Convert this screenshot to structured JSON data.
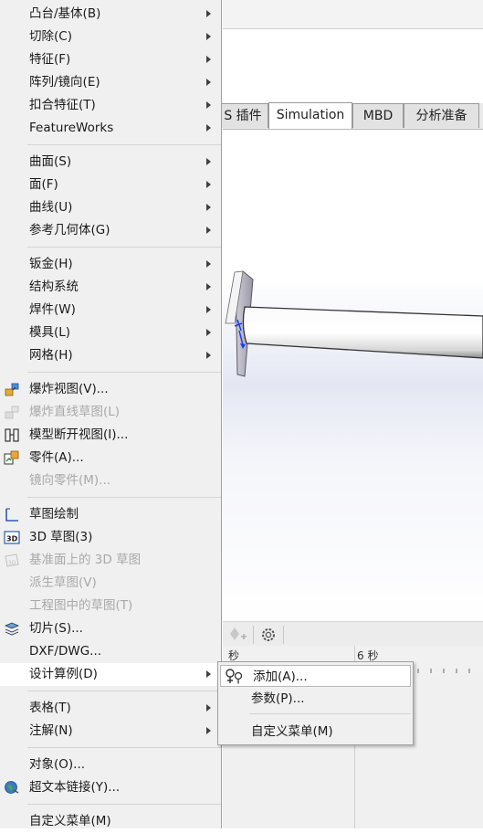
{
  "tabs": [
    "S 插件",
    "Simulation",
    "MBD",
    "分析准备"
  ],
  "ruler": {
    "left_label": "秒",
    "right_label": "6 秒"
  },
  "menu": {
    "groups": [
      [
        {
          "label": "凸台/基体(B)",
          "submenu": true
        },
        {
          "label": "切除(C)",
          "submenu": true
        },
        {
          "label": "特征(F)",
          "submenu": true
        },
        {
          "label": "阵列/镜向(E)",
          "submenu": true
        },
        {
          "label": "扣合特征(T)",
          "submenu": true
        },
        {
          "label": "FeatureWorks",
          "submenu": true
        }
      ],
      [
        {
          "label": "曲面(S)",
          "submenu": true
        },
        {
          "label": "面(F)",
          "submenu": true
        },
        {
          "label": "曲线(U)",
          "submenu": true
        },
        {
          "label": "参考几何体(G)",
          "submenu": true
        }
      ],
      [
        {
          "label": "钣金(H)",
          "submenu": true
        },
        {
          "label": "结构系统",
          "submenu": true
        },
        {
          "label": "焊件(W)",
          "submenu": true
        },
        {
          "label": "模具(L)",
          "submenu": true
        },
        {
          "label": "网格(H)",
          "submenu": true
        }
      ],
      [
        {
          "label": "爆炸视图(V)...",
          "icon": "explode-view-icon"
        },
        {
          "label": "爆炸直线草图(L)",
          "icon": "explode-line-sketch-icon",
          "disabled": true
        },
        {
          "label": "模型断开视图(I)...",
          "icon": "broken-view-icon"
        },
        {
          "label": "零件(A)...",
          "icon": "part-icon"
        },
        {
          "label": "镜向零件(M)...",
          "disabled": true
        }
      ],
      [
        {
          "label": "草图绘制",
          "icon": "sketch-icon"
        },
        {
          "label": "3D 草图(3)",
          "icon": "3d-sketch-icon"
        },
        {
          "label": "基准面上的 3D 草图",
          "icon": "3d-sketch-on-plane-icon",
          "disabled": true
        },
        {
          "label": "派生草图(V)",
          "disabled": true
        },
        {
          "label": "工程图中的草图(T)",
          "disabled": true
        },
        {
          "label": "切片(S)...",
          "icon": "slice-icon"
        },
        {
          "label": "DXF/DWG..."
        },
        {
          "label": "设计算例(D)",
          "submenu": true,
          "highlighted": true
        }
      ],
      [
        {
          "label": "表格(T)",
          "submenu": true
        },
        {
          "label": "注解(N)",
          "submenu": true
        }
      ],
      [
        {
          "label": "对象(O)..."
        },
        {
          "label": "超文本链接(Y)...",
          "icon": "hyperlink-icon"
        }
      ],
      [
        {
          "label": "自定义菜单(M)"
        }
      ]
    ]
  },
  "submenu": {
    "items": [
      {
        "label": "添加(A)...",
        "icon": "add-design-study-icon",
        "highlighted": true
      },
      {
        "label": "参数(P)..."
      },
      {
        "label": "自定义菜单(M)"
      }
    ]
  }
}
